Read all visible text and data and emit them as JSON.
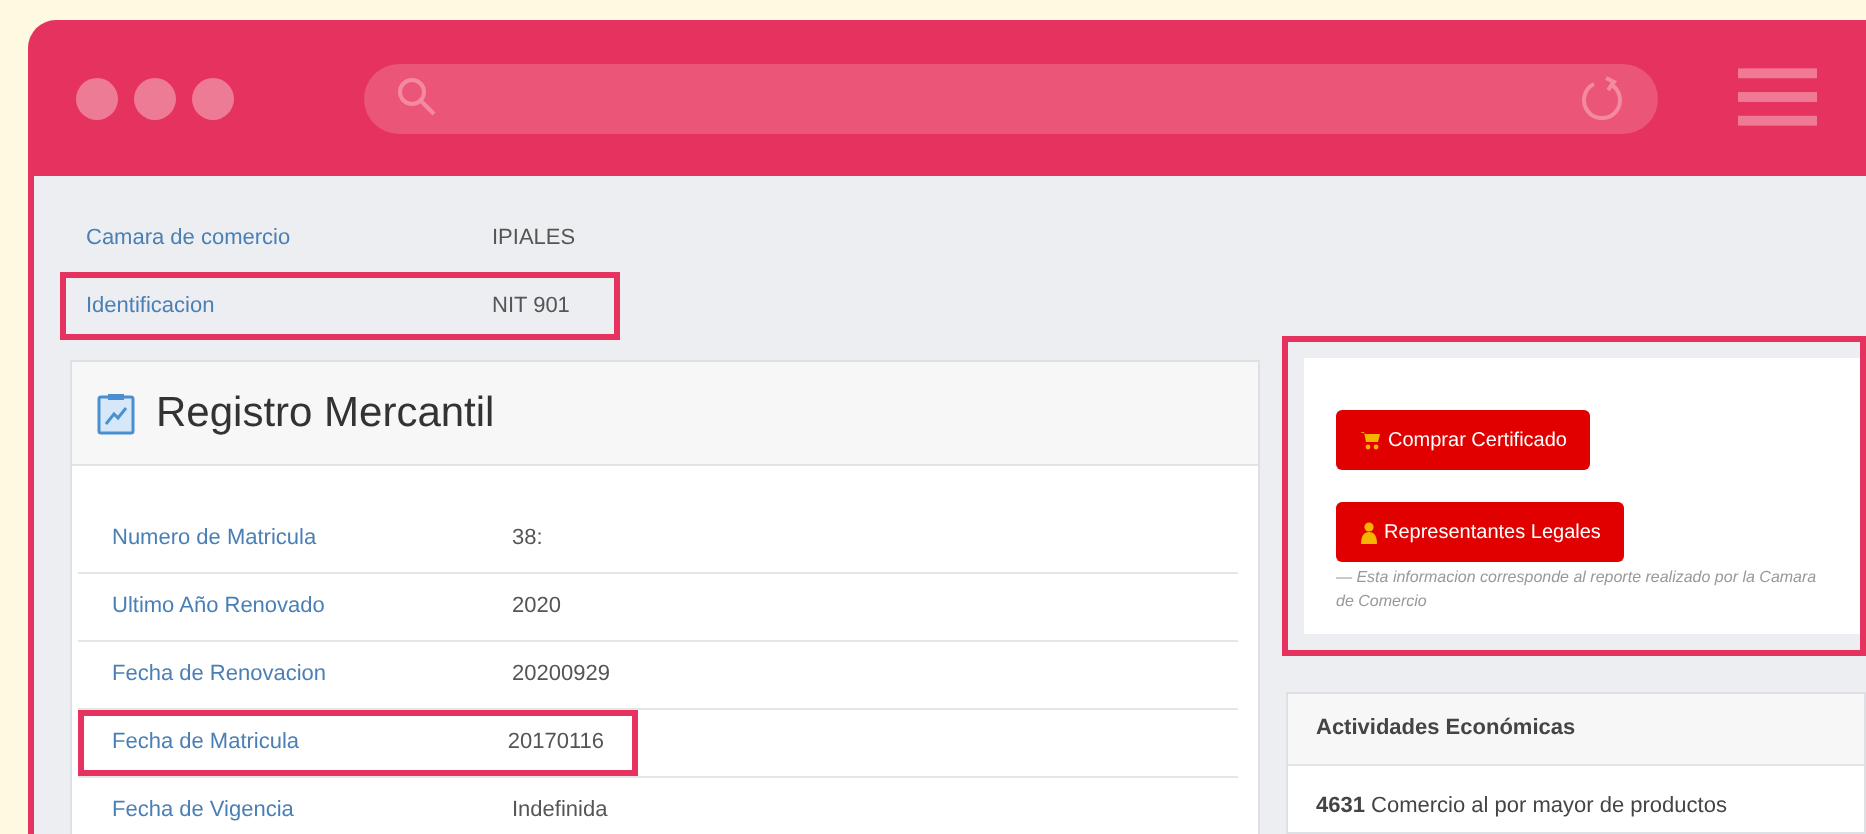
{
  "top_rows": [
    {
      "label": "Camara de comercio",
      "value": "IPIALES",
      "highlighted": false
    },
    {
      "label": "Identificacion",
      "value": "NIT 901",
      "highlighted": true
    }
  ],
  "registro": {
    "title": "Registro Mercantil",
    "rows": [
      {
        "label": "Numero de Matricula",
        "value": "38:",
        "highlighted": false
      },
      {
        "label": "Ultimo Año Renovado",
        "value": "2020",
        "highlighted": false
      },
      {
        "label": "Fecha de Renovacion",
        "value": "20200929",
        "highlighted": false
      },
      {
        "label": "Fecha de Matricula",
        "value": "20170116",
        "highlighted": true
      },
      {
        "label": "Fecha de Vigencia",
        "value": "Indefinida",
        "highlighted": false
      }
    ]
  },
  "actions": {
    "highlighted": true,
    "buttons": [
      {
        "label": "Comprar Certificado"
      },
      {
        "label": "Representantes Legales"
      }
    ],
    "note": "— Esta informacion corresponde al reporte realizado por la Camara de Comercio"
  },
  "actividades": {
    "title": "Actividades Económicas",
    "items": [
      "**4631** Comercio al por mayor de productos"
    ]
  }
}
